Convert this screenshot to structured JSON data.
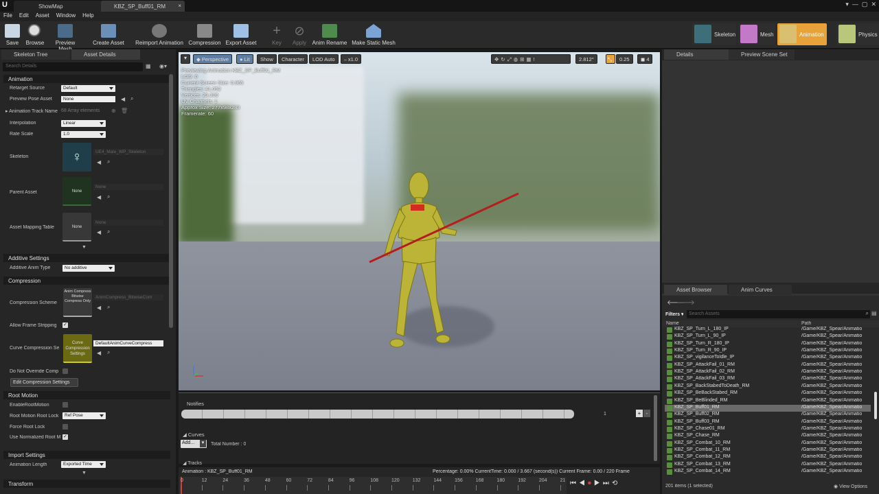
{
  "tabs": [
    "ShowMap",
    "KBZ_SP_Buff01_RM"
  ],
  "menu": [
    "File",
    "Edit",
    "Asset",
    "Window",
    "Help"
  ],
  "toolbar": {
    "save": "Save",
    "browse": "Browse",
    "preview_mesh": "Preview Mesh",
    "create_asset": "Create Asset",
    "reimport": "Reimport Animation",
    "compression": "Compression",
    "export": "Export Asset",
    "key": "Key",
    "apply": "Apply",
    "anim_rename": "Anim Rename",
    "make_static": "Make Static Mesh"
  },
  "modes": {
    "skeleton": "Skeleton",
    "mesh": "Mesh",
    "animation": "Animation",
    "physics": "Physics"
  },
  "left": {
    "tab_tree": "Skeleton Tree",
    "tab_details": "Asset Details",
    "search_placeholder": "Search Details",
    "sec_animation": "Animation",
    "retarget_label": "Retarget Source",
    "retarget_value": "Default",
    "preview_pose_label": "Preview Pose Asset",
    "preview_pose_value": "None",
    "track_names_label": "Animation Track Name",
    "track_names_value": "68 Array elements",
    "interp_label": "Interpolation",
    "interp_value": "Linear",
    "rate_label": "Rate Scale",
    "rate_value": "1.0",
    "skeleton_label": "Skeleton",
    "skeleton_value": "UE4_Male_WP_Skeleton",
    "parent_label": "Parent Asset",
    "parent_thumb": "None",
    "parent_value": "None",
    "mapping_label": "Asset Mapping Table",
    "mapping_thumb": "None",
    "mapping_value": "None",
    "sec_additive": "Additive Settings",
    "additive_label": "Additive Anim Type",
    "additive_value": "No additive",
    "sec_compression": "Compression",
    "scheme_label": "Compression Scheme",
    "scheme_thumb": "Anim Compress Bitwise Compress Only",
    "scheme_value": "AnimCompress_BitwiseCom",
    "strip_label": "Allow Frame Stripping",
    "curve_label": "Curve Compression Se",
    "curve_thumb": "Curve Compression Settings",
    "curve_value": "DefaultAnimCurveCompress",
    "override_label": "Do Not Override Comp",
    "edit_comp": "Edit Compression Settings",
    "sec_root": "Root Motion",
    "enable_root": "EnableRootMotion",
    "root_lock_label": "Root Motion Root Lock",
    "root_lock_value": "Ref Pose",
    "force_root": "Force Root Lock",
    "normalized_root": "Use Normalized Root M",
    "sec_import": "Import Settings",
    "length_label": "Animation Length",
    "length_value": "Exported Time",
    "sec_transform": "Transform"
  },
  "viewport": {
    "perspective": "Perspective",
    "lit": "Lit",
    "show": "Show",
    "character": "Character",
    "lod": "LOD Auto",
    "speed": "x1.0",
    "fov": "2.812°",
    "snap": "0.25",
    "cam": "4",
    "stats": [
      "Previewing Animation KBZ_SP_Buff01_RM",
      "LOD: 0",
      "Current Screen Size: 0.965",
      "Triangles: 41,052",
      "Vertices: 23,309",
      "UV Channels: 1",
      "Approx Size: 277x98x283",
      "Framerate: 60"
    ]
  },
  "timeline": {
    "notifies": "Notifies",
    "track_num": "1",
    "curves": "Curves",
    "add": "Add...",
    "total": "Total Number : 0",
    "tracks": "Tracks"
  },
  "bottom": {
    "anim_label": "Animation : KBZ_SP_Buff01_RM",
    "info": "Percentage: 0.00% CurrentTime: 0.000 / 3.667 (second(s)) Current Frame: 0.00 / 220 Frame",
    "ticks": [
      "0",
      "12",
      "24",
      "36",
      "48",
      "60",
      "72",
      "84",
      "96",
      "108",
      "120",
      "132",
      "144",
      "156",
      "168",
      "180",
      "192",
      "204",
      "21"
    ]
  },
  "right": {
    "details": "Details",
    "preview_scene": "Preview Scene Set",
    "asset_browser": "Asset Browser",
    "anim_curves": "Anim Curves",
    "filters": "Filters",
    "search_placeholder": "Search Assets",
    "col_name": "Name",
    "col_path": "Path",
    "items": [
      {
        "name": "KBZ_SP_Turn_L_180_IP",
        "path": "/Game/KBZ_Spear/Animatio"
      },
      {
        "name": "KBZ_SP_Turn_L_90_IP",
        "path": "/Game/KBZ_Spear/Animatio"
      },
      {
        "name": "KBZ_SP_Turn_R_180_IP",
        "path": "/Game/KBZ_Spear/Animatio"
      },
      {
        "name": "KBZ_SP_Turn_R_90_IP",
        "path": "/Game/KBZ_Spear/Animatio"
      },
      {
        "name": "KBZ_SP_vigilanceToIdle_IP",
        "path": "/Game/KBZ_Spear/Animatio"
      },
      {
        "name": "KBZ_SP_AttackFail_01_RM",
        "path": "/Game/KBZ_Spear/Animatio"
      },
      {
        "name": "KBZ_SP_AttackFail_02_RM",
        "path": "/Game/KBZ_Spear/Animatio"
      },
      {
        "name": "KBZ_SP_AttackFail_03_RM",
        "path": "/Game/KBZ_Spear/Animatio"
      },
      {
        "name": "KBZ_SP_BackStabedToDeath_RM",
        "path": "/Game/KBZ_Spear/Animatio"
      },
      {
        "name": "KBZ_SP_BeBackStabed_RM",
        "path": "/Game/KBZ_Spear/Animatio"
      },
      {
        "name": "KBZ_SP_BeBlinded_RM",
        "path": "/Game/KBZ_Spear/Animatio"
      },
      {
        "name": "KBZ_SP_Buff01_RM",
        "path": "/Game/KBZ_Spear/Animatio"
      },
      {
        "name": "KBZ_SP_Buff02_RM",
        "path": "/Game/KBZ_Spear/Animatio"
      },
      {
        "name": "KBZ_SP_Buff03_RM",
        "path": "/Game/KBZ_Spear/Animatio"
      },
      {
        "name": "KBZ_SP_Chase01_RM",
        "path": "/Game/KBZ_Spear/Animatio"
      },
      {
        "name": "KBZ_SP_Chase_RM",
        "path": "/Game/KBZ_Spear/Animatio"
      },
      {
        "name": "KBZ_SP_Combat_10_RM",
        "path": "/Game/KBZ_Spear/Animatio"
      },
      {
        "name": "KBZ_SP_Combat_11_RM",
        "path": "/Game/KBZ_Spear/Animatio"
      },
      {
        "name": "KBZ_SP_Combat_12_RM",
        "path": "/Game/KBZ_Spear/Animatio"
      },
      {
        "name": "KBZ_SP_Combat_13_RM",
        "path": "/Game/KBZ_Spear/Animatio"
      },
      {
        "name": "KBZ_SP_Combat_14_RM",
        "path": "/Game/KBZ_Spear/Animatio"
      }
    ],
    "selected_index": 11,
    "status": "201 items (1 selected)",
    "view_options": "View Options"
  },
  "colors": {
    "accent": "#e8a23a",
    "panel": "#262626",
    "selected_row": "#6a6a6a",
    "anim_icon": "#5a8f3a"
  }
}
